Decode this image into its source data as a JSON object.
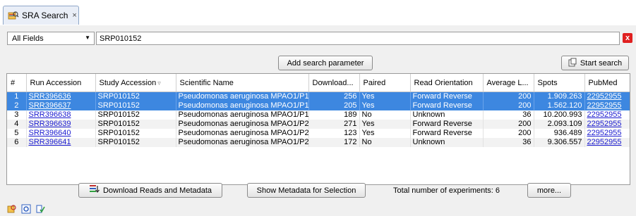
{
  "tab": {
    "title": "SRA Search",
    "close": "×"
  },
  "search": {
    "field": "All Fields",
    "query": "SRP010152",
    "clear": "x"
  },
  "buttons": {
    "add_param": "Add search parameter",
    "start_search": "Start search",
    "download": "Download Reads and Metadata",
    "show_meta": "Show Metadata for Selection",
    "more": "more..."
  },
  "total_label": "Total number of experiments: 6",
  "columns": [
    "#",
    "Run Accession",
    "Study Accession",
    "Scientific Name",
    "Download...",
    "Paired",
    "Read Orientation",
    "Average L...",
    "Spots",
    "PubMed"
  ],
  "rows": [
    {
      "n": "1",
      "run": "SRR396636",
      "study": "SRP010152",
      "name": "Pseudomonas aeruginosa MPAO1/P1",
      "dl": "256",
      "paired": "Yes",
      "orient": "Forward Reverse",
      "avg": "200",
      "spots": "1.909.263",
      "pubmed": "22952955",
      "selected": true
    },
    {
      "n": "2",
      "run": "SRR396637",
      "study": "SRP010152",
      "name": "Pseudomonas aeruginosa MPAO1/P1",
      "dl": "205",
      "paired": "Yes",
      "orient": "Forward Reverse",
      "avg": "200",
      "spots": "1.562.120",
      "pubmed": "22952955",
      "selected": true
    },
    {
      "n": "3",
      "run": "SRR396638",
      "study": "SRP010152",
      "name": "Pseudomonas aeruginosa MPAO1/P1",
      "dl": "189",
      "paired": "No",
      "orient": "Unknown",
      "avg": "36",
      "spots": "10.200.993",
      "pubmed": "22952955",
      "selected": false
    },
    {
      "n": "4",
      "run": "SRR396639",
      "study": "SRP010152",
      "name": "Pseudomonas aeruginosa MPAO1/P2",
      "dl": "271",
      "paired": "Yes",
      "orient": "Forward Reverse",
      "avg": "200",
      "spots": "2.093.109",
      "pubmed": "22952955",
      "selected": false
    },
    {
      "n": "5",
      "run": "SRR396640",
      "study": "SRP010152",
      "name": "Pseudomonas aeruginosa MPAO1/P2",
      "dl": "123",
      "paired": "Yes",
      "orient": "Forward Reverse",
      "avg": "200",
      "spots": "936.489",
      "pubmed": "22952955",
      "selected": false
    },
    {
      "n": "6",
      "run": "SRR396641",
      "study": "SRP010152",
      "name": "Pseudomonas aeruginosa MPAO1/P2",
      "dl": "172",
      "paired": "No",
      "orient": "Unknown",
      "avg": "36",
      "spots": "9.306.557",
      "pubmed": "22952955",
      "selected": false
    }
  ],
  "colors": {
    "selection": "#3d87e0",
    "link": "#1a1ad0",
    "clear": "#e02020"
  },
  "icons": {
    "tab": "sra-search-icon",
    "start": "start-search-icon",
    "download": "download-icon",
    "footer": [
      "sra-search-icon",
      "settings-icon",
      "help-icon"
    ]
  }
}
